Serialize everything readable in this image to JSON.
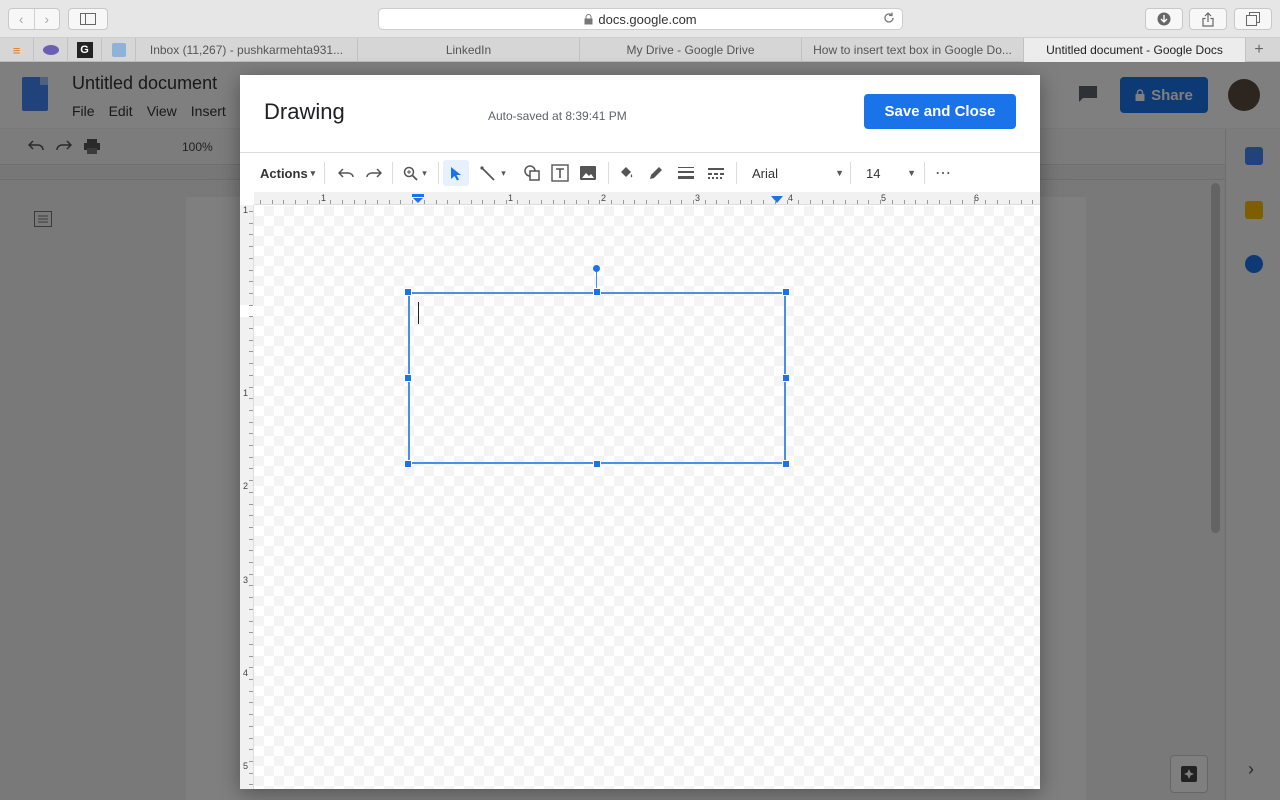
{
  "browser": {
    "url": "docs.google.com",
    "tabs": [
      {
        "label": "Inbox (11,267) - pushkarmehta931...",
        "active": false
      },
      {
        "label": "LinkedIn",
        "active": false
      },
      {
        "label": "My Drive - Google Drive",
        "active": false
      },
      {
        "label": "How to insert text box in Google Do...",
        "active": false
      },
      {
        "label": "Untitled document - Google Docs",
        "active": true
      }
    ],
    "pinned_tabs": [
      "stackoverflow-icon",
      "bird-icon",
      "grammarly-icon",
      "puzzle-icon"
    ],
    "new_tab_label": "+"
  },
  "docs": {
    "title": "Untitled document",
    "menu": [
      "File",
      "Edit",
      "View",
      "Insert"
    ],
    "share_label": "Share",
    "zoom": "100%",
    "brand_color": "#1a73e8"
  },
  "drawing": {
    "title": "Drawing",
    "autosave": "Auto-saved at 8:39:41 PM",
    "save_close_label": "Save and Close",
    "toolbar": {
      "actions_label": "Actions",
      "font": "Arial",
      "font_size": "14",
      "more_label": "⋯",
      "selected_tool": "select-icon"
    },
    "ruler_h": [
      "1",
      "1",
      "2",
      "3",
      "4",
      "5",
      "6"
    ],
    "ruler_v": [
      "1",
      "1",
      "2",
      "3",
      "4",
      "5"
    ]
  }
}
